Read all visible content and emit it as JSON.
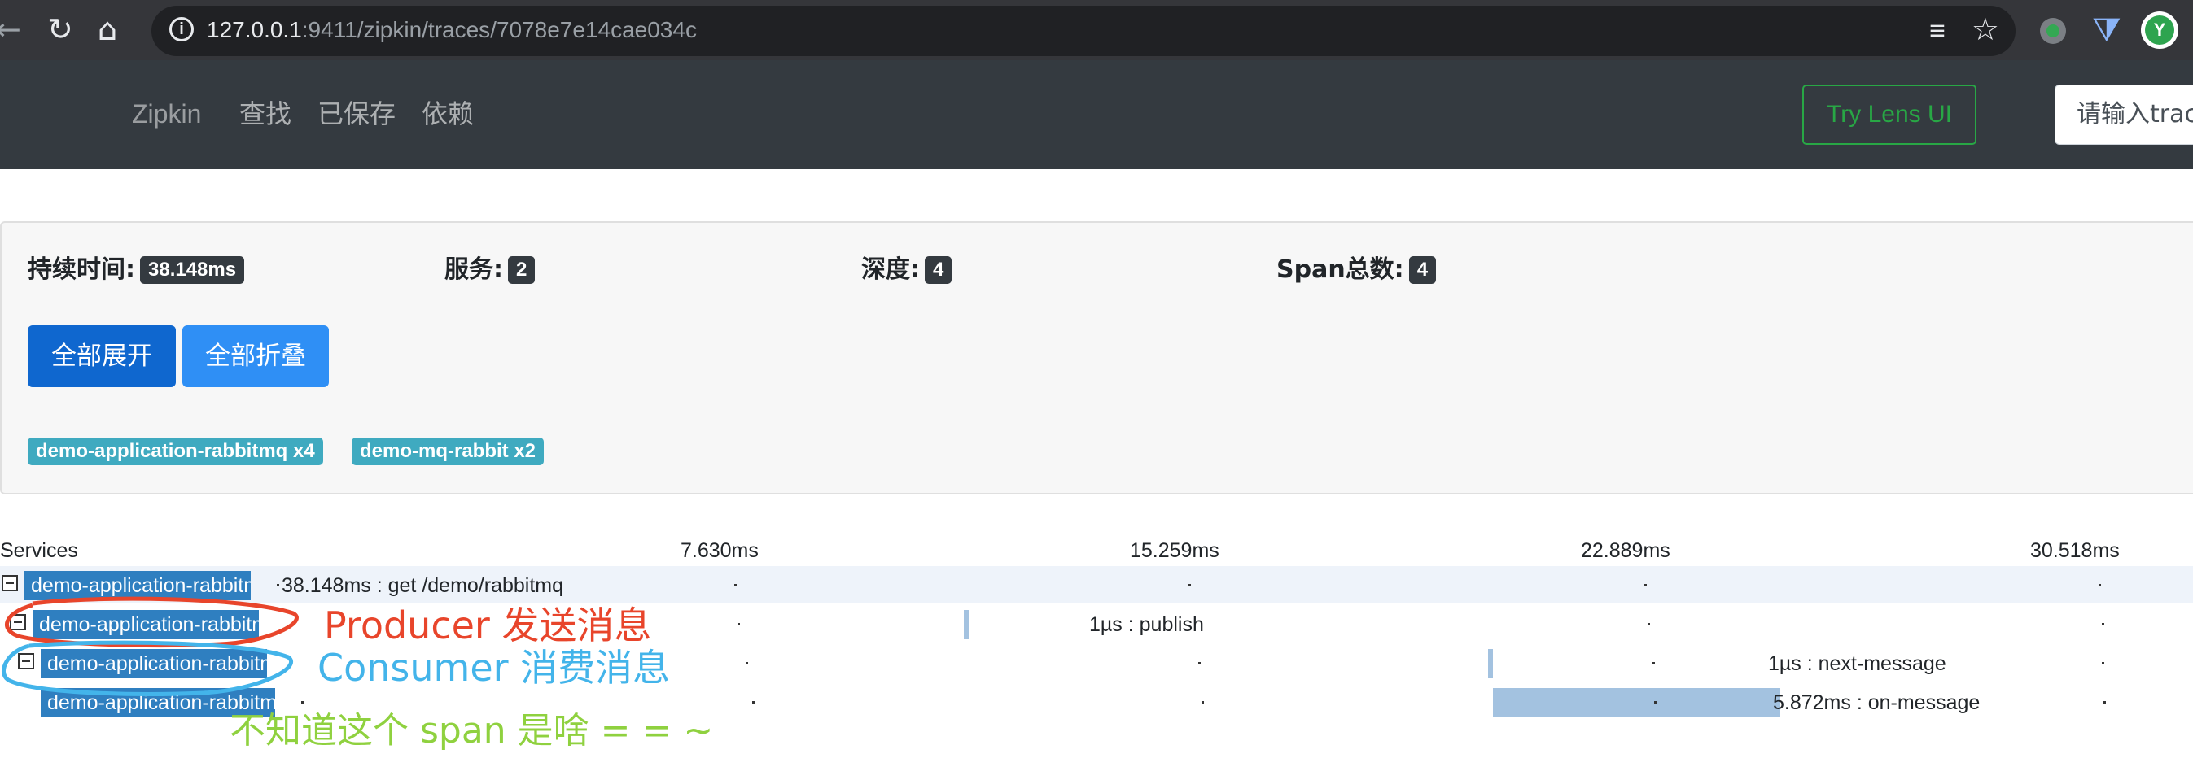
{
  "browser": {
    "back_icon": "←",
    "reload_icon": "↻",
    "home_icon": "⌂",
    "url_host": "127.0.0.1",
    "url_rest": ":9411/zipkin/traces/7078e7e14cae034c",
    "reader_icon": "≡",
    "star_icon": "☆",
    "ext2_icon": "⧩"
  },
  "navbar": {
    "brand": "Zipkin",
    "links": [
      "查找",
      "已保存",
      "依赖"
    ],
    "lens_button": "Try Lens UI",
    "search_placeholder": "请输入trace id"
  },
  "summary": {
    "duration_label": "持续时间:",
    "duration_value": "38.148ms",
    "services_label": "服务:",
    "services_value": "2",
    "depth_label": "深度:",
    "depth_value": "4",
    "spans_label": "Span总数:",
    "spans_value": "4",
    "expand_all": "全部展开",
    "collapse_all": "全部折叠",
    "service_badges": [
      "demo-application-rabbitmq x4",
      "demo-mq-rabbit x2"
    ]
  },
  "timeline": {
    "services_header": "Services",
    "ticks": [
      "7.630ms",
      "15.259ms",
      "22.889ms",
      "30.518ms"
    ],
    "total_ms": 38.148,
    "rows": [
      {
        "service": "demo-application-rabbitmq",
        "label": "38.148ms : get /demo/rabbitmq",
        "start_ms": 0,
        "duration_ms": 38.148
      },
      {
        "service": "demo-application-rabbitmq",
        "label": "1µs : publish",
        "start_ms": 14.11,
        "duration_ms": 0.001
      },
      {
        "service": "demo-application-rabbitmq",
        "label": "1µs : next-message",
        "start_ms": 24.85,
        "duration_ms": 0.001
      },
      {
        "service": "demo-application-rabbitmq",
        "label": "5.872ms : on-message",
        "start_ms": 24.95,
        "duration_ms": 5.872
      }
    ],
    "bar_color": "#a3c2e0",
    "row_highlight": "#eef3fa"
  },
  "annotations": {
    "producer": "Producer 发送消息",
    "consumer": "Consumer 消费消息",
    "question": "不知道这个 span 是啥 = = ~",
    "producer_color": "#e8452b",
    "consumer_color": "#43b4ea",
    "question_color": "#8fd13f"
  }
}
